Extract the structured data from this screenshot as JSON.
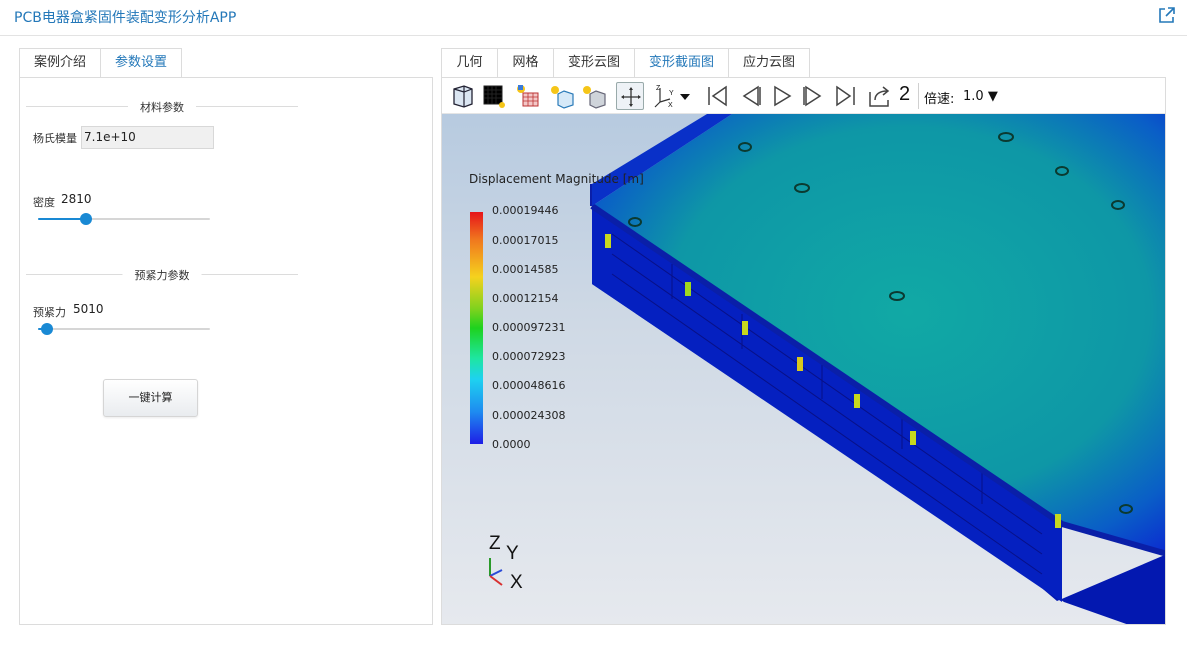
{
  "app": {
    "title": "PCB电器盒紧固件装配变形分析APP"
  },
  "left_tabs": [
    {
      "label": "案例介绍",
      "active": false
    },
    {
      "label": "参数设置",
      "active": true
    }
  ],
  "params": {
    "material_section": "材料参数",
    "youngs_label": "杨氏模量",
    "youngs_value": "7.1e+10",
    "density_label": "密度",
    "density_value": "2810",
    "density_slider_fraction": 0.28,
    "preload_section": "预紧力参数",
    "preload_label": "预紧力",
    "preload_value": "5010",
    "preload_slider_fraction": 0.05,
    "calc_button": "一键计算"
  },
  "right_tabs": [
    {
      "label": "几何",
      "active": false
    },
    {
      "label": "网格",
      "active": false
    },
    {
      "label": "变形云图",
      "active": false
    },
    {
      "label": "变形截面图",
      "active": true
    },
    {
      "label": "应力云图",
      "active": false
    }
  ],
  "toolbar": {
    "icons": [
      "view-cube-icon",
      "wireframe-grid-icon",
      "light-mesh-icon",
      "light-box-icon",
      "light-box-solid-icon",
      "fit-view-icon",
      "axes-dropdown-icon",
      "first-frame-icon",
      "prev-frame-icon",
      "play-icon",
      "next-frame-icon",
      "last-frame-icon",
      "export-icon"
    ],
    "frame": "2",
    "speed_label": "倍速:",
    "speed_value": "1.0"
  },
  "legend": {
    "title": "Displacement Magnitude [m]",
    "ticks": [
      "0.00019446",
      "0.00017015",
      "0.00014585",
      "0.00012154",
      "0.000097231",
      "0.000072923",
      "0.000048616",
      "0.000024308",
      "0.0000"
    ]
  },
  "axes_labels": {
    "z": "Z",
    "y": "Y",
    "x": "X"
  },
  "colors": {
    "accent": "#2478b9",
    "slider": "#1989d4"
  }
}
